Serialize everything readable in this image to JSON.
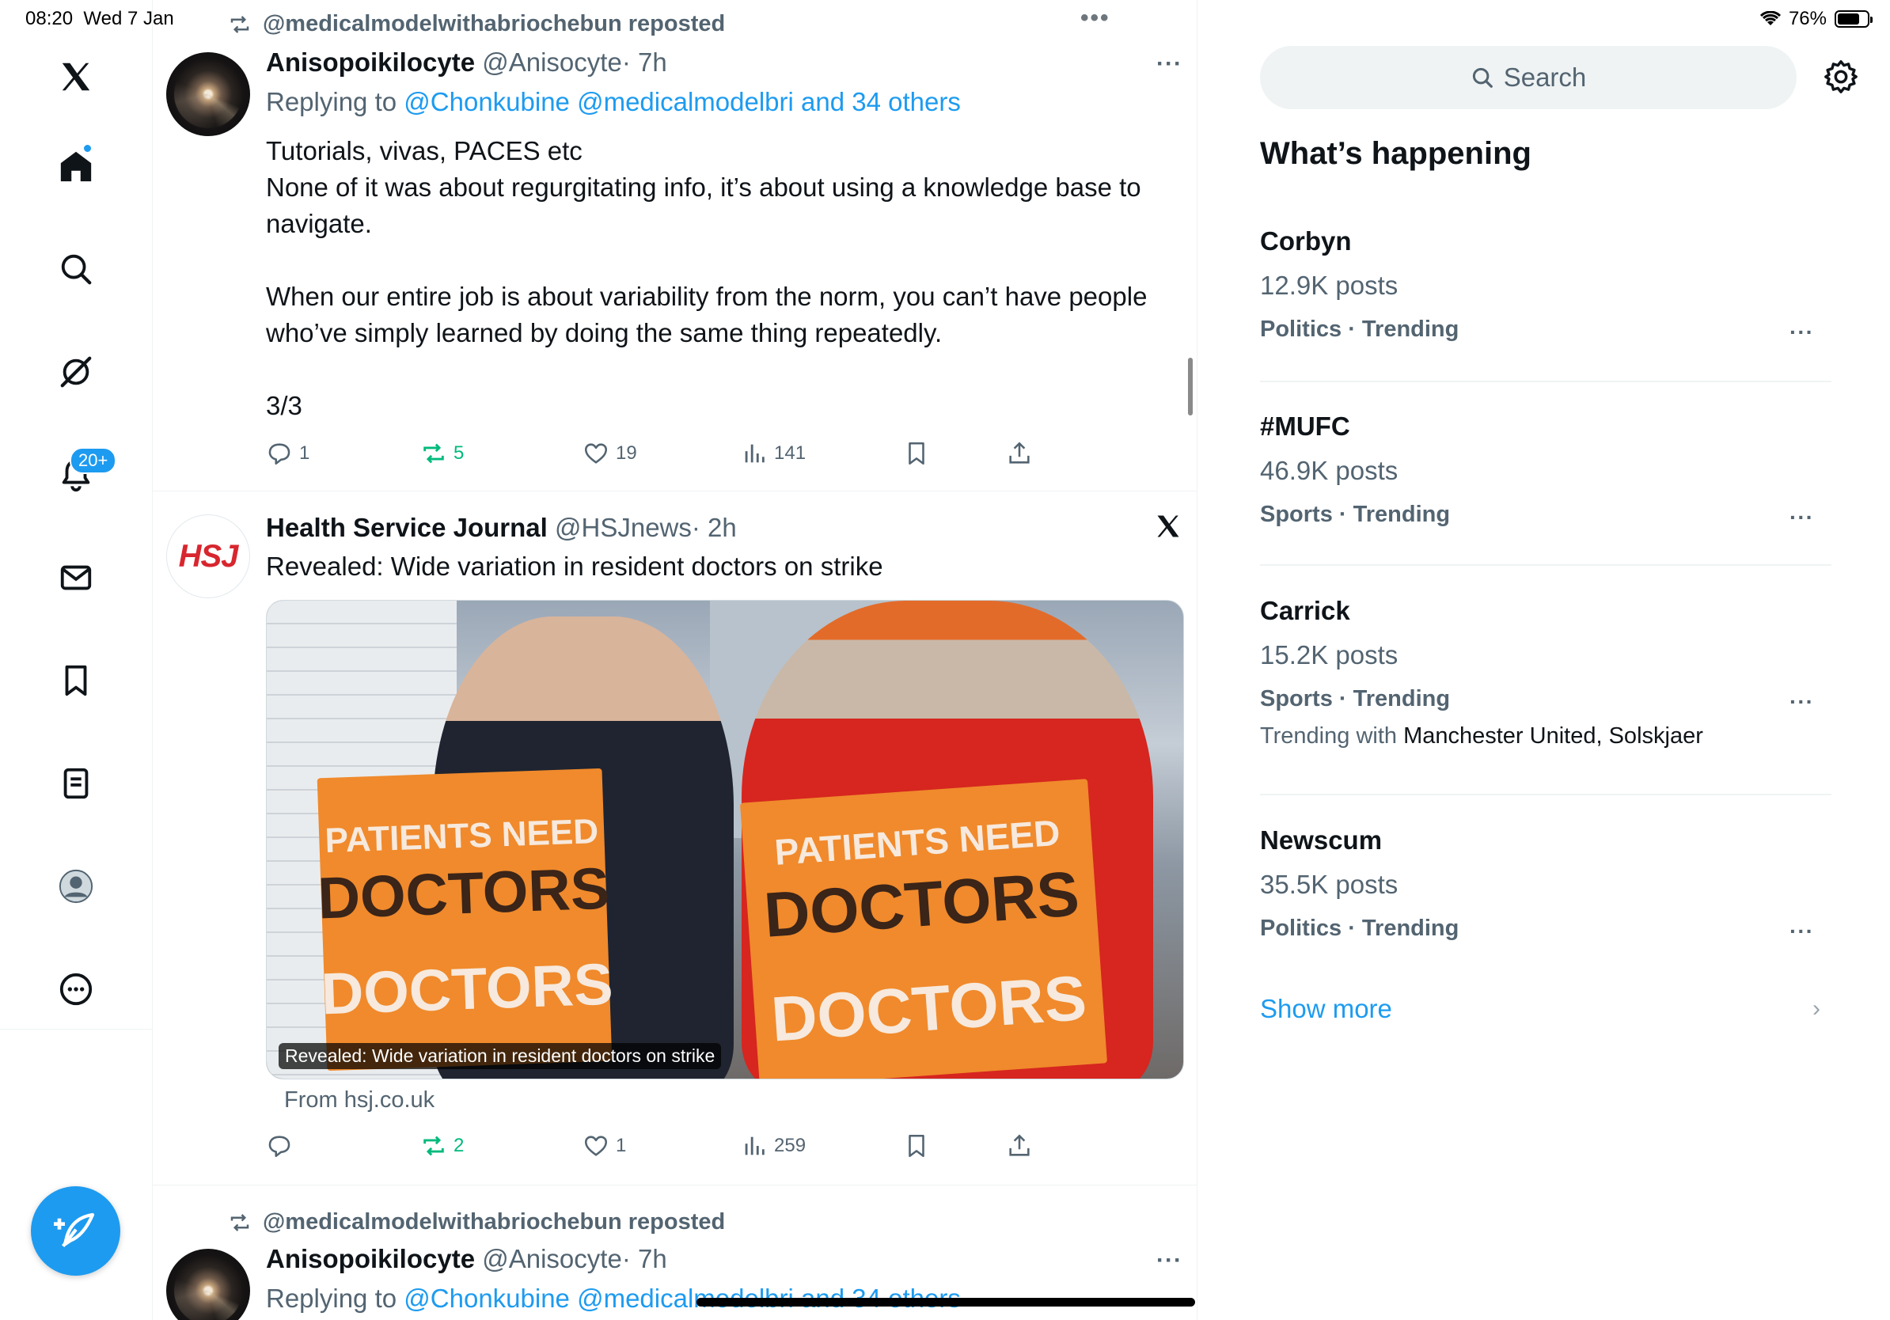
{
  "status": {
    "time": "08:20",
    "date": "Wed 7 Jan",
    "battery": "76%",
    "battery_level": 0.76
  },
  "nav": {
    "notifications_badge": "20+"
  },
  "feed": {
    "post1": {
      "repost_label": "@medicalmodelwithabriochebun reposted",
      "name": "Anisopoikilocyte",
      "handle": "@Anisocyte",
      "time": "· 7h",
      "reply_prefix": "Replying to",
      "reply_links": "@Chonkubine @medicalmodelbri and 34 others",
      "text_line1": "Tutorials, vivas, PACES etc",
      "text_line2": "None of it was about regurgitating info, it’s about using a knowledge base to navigate.",
      "text_line3": "When our entire job is about variability from the norm, you can’t have people who’ve simply learned by doing the same thing repeatedly.",
      "text_line4": "3/3",
      "replies": "1",
      "reposts": "5",
      "likes": "19",
      "views": "141"
    },
    "post2": {
      "name": "Health Service Journal",
      "handle": "@HSJnews",
      "time": "· 2h",
      "avatar_text": "HSJ",
      "text": "Revealed: Wide variation in resident doctors on strike",
      "card_caption": "Revealed: Wide variation in resident doctors on strike",
      "card_sign_left_top": "PATIENTS NEED",
      "card_sign_left_big": "DOCTORS",
      "card_sign_left_bottom": "DOCTORS",
      "card_sign_right_top": "PATIENTS NEED",
      "card_sign_right_big": "DOCTORS",
      "card_sign_right_bottom": "DOCTORS",
      "from": "From hsj.co.uk",
      "replies": "",
      "reposts": "2",
      "likes": "1",
      "views": "259"
    },
    "post3": {
      "repost_label": "@medicalmodelwithabriochebun reposted",
      "name": "Anisopoikilocyte",
      "handle": "@Anisocyte",
      "time": "· 7h",
      "reply_prefix": "Replying to",
      "reply_links": "@Chonkubine @medicalmodelbri and 34 others"
    }
  },
  "sidebar": {
    "search_placeholder": "Search",
    "title": "What’s happening",
    "trends": [
      {
        "name": "Corbyn",
        "count": "12.9K posts",
        "category": "Politics · Trending"
      },
      {
        "name": "#MUFC",
        "count": "46.9K posts",
        "category": "Sports · Trending"
      },
      {
        "name": "Carrick",
        "count": "15.2K posts",
        "category": "Sports · Trending",
        "with_prefix": "Trending with",
        "with_names": "Manchester United, Solskjaer"
      },
      {
        "name": "Newscum",
        "count": "35.5K posts",
        "category": "Politics · Trending"
      }
    ],
    "show_more": "Show more"
  },
  "colors": {
    "accent": "#1d9bf0",
    "repost_green": "#00ba7c",
    "muted": "#536471",
    "text": "#0f1419"
  }
}
